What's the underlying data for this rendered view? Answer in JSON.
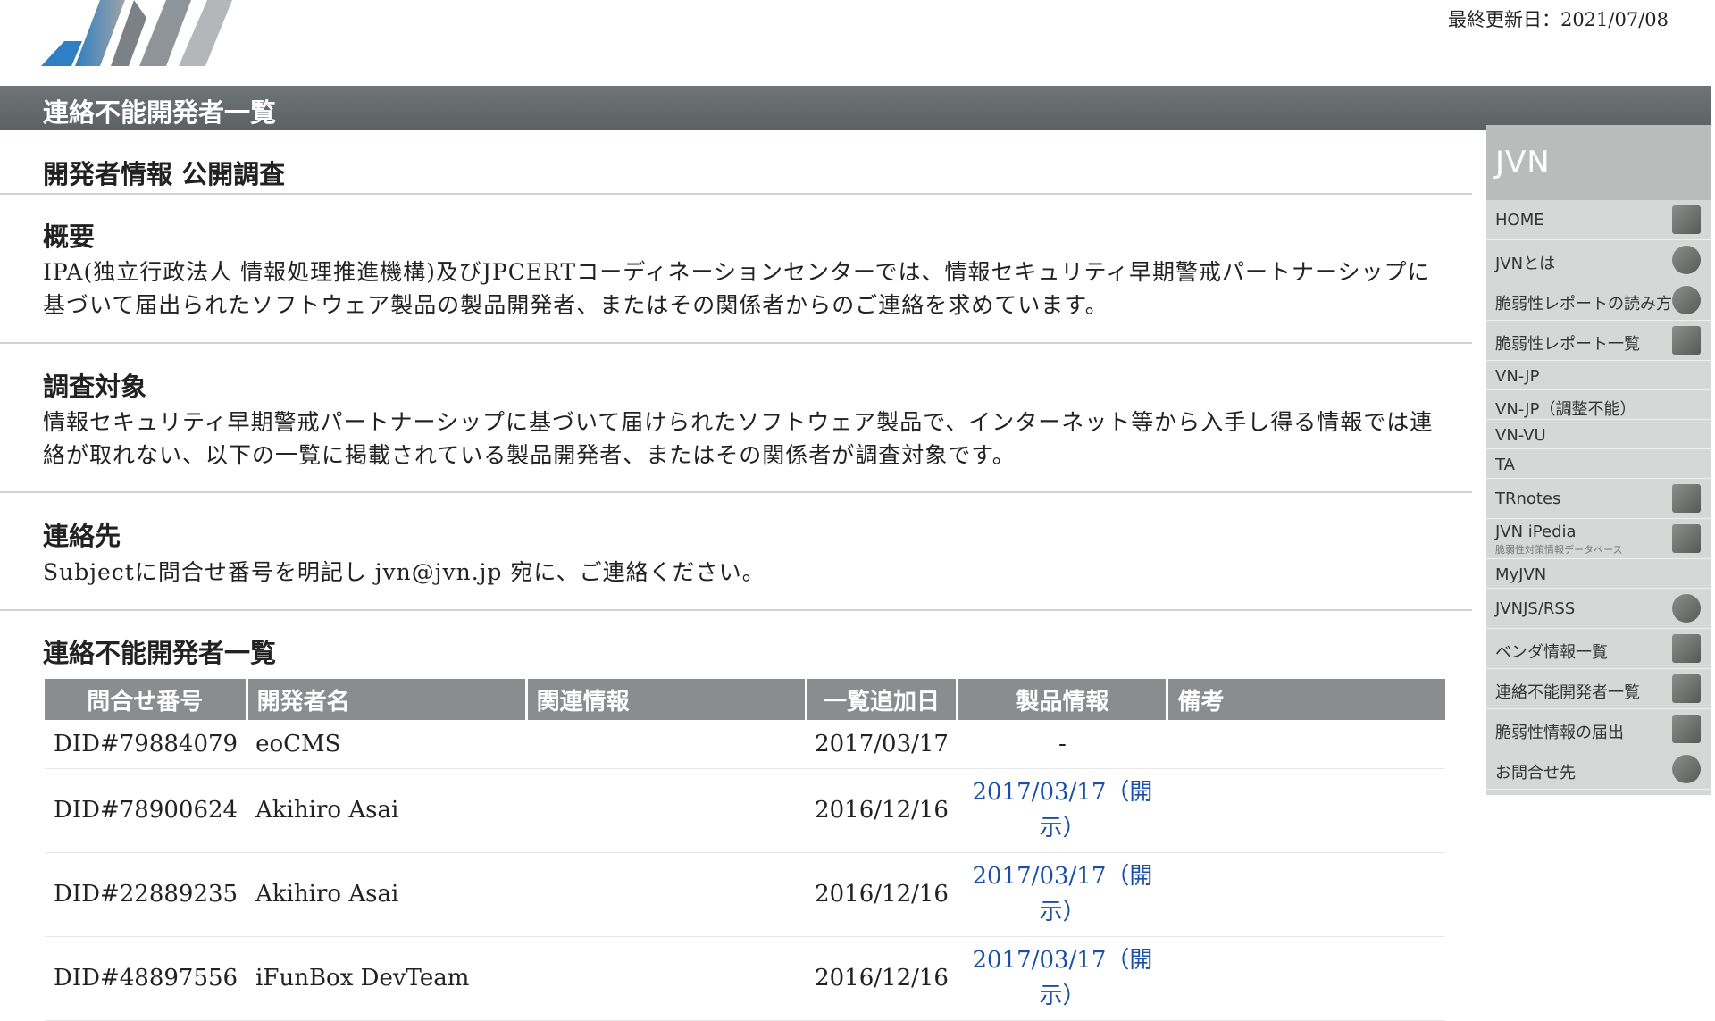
{
  "header": {
    "updated_label": "最終更新日：",
    "updated_date": "2021/07/08",
    "title": "連絡不能開発者一覧"
  },
  "main": {
    "subtitle": "開発者情報 公開調査",
    "sections": [
      {
        "heading": "概要",
        "text": "IPA(独立行政法人 情報処理推進機構)及びJPCERTコーディネーションセンターでは、情報セキュリティ早期警戒パートナーシップに基づいて届出られたソフトウェア製品の製品開発者、またはその関係者からのご連絡を求めています。"
      },
      {
        "heading": "調査対象",
        "text": "情報セキュリティ早期警戒パートナーシップに基づいて届けられたソフトウェア製品で、インターネット等から入手し得る情報では連絡が取れない、以下の一覧に掲載されている製品開発者、またはその関係者が調査対象です。"
      },
      {
        "heading": "連絡先",
        "text": "Subjectに問合せ番号を明記し jvn@jvn.jp 宛に、ご連絡ください。"
      }
    ],
    "list_heading": "連絡不能開発者一覧",
    "table": {
      "headers": [
        "問合せ番号",
        "開発者名",
        "関連情報",
        "一覧追加日",
        "製品情報",
        "備考"
      ],
      "rows": [
        {
          "id": "DID#79884079",
          "developer": "eoCMS",
          "related": "",
          "added": "2017/03/17",
          "product": "-",
          "product_link": false,
          "note": ""
        },
        {
          "id": "DID#78900624",
          "developer": "Akihiro Asai",
          "related": "",
          "added": "2016/12/16",
          "product": "2017/03/17（開示）",
          "product_link": true,
          "note": ""
        },
        {
          "id": "DID#22889235",
          "developer": "Akihiro Asai",
          "related": "",
          "added": "2016/12/16",
          "product": "2017/03/17（開示）",
          "product_link": true,
          "note": ""
        },
        {
          "id": "DID#48897556",
          "developer": "iFunBox DevTeam",
          "related": "",
          "added": "2016/12/16",
          "product": "2017/03/17（開示）",
          "product_link": true,
          "note": ""
        }
      ]
    }
  },
  "sidebar": {
    "brand": "JVN",
    "items": [
      {
        "label": "HOME",
        "icon": "building-icon"
      },
      {
        "label": "JVNとは",
        "icon": "globe-icon"
      },
      {
        "label": "脆弱性レポートの読み方",
        "icon": "eye-icon"
      },
      {
        "label": "脆弱性レポート一覧",
        "icon": "list-icon"
      },
      {
        "label": "VN-JP",
        "icon": ""
      },
      {
        "label": "VN-JP（調整不能）",
        "icon": ""
      },
      {
        "label": "VN-VU",
        "icon": ""
      },
      {
        "label": "TA",
        "icon": ""
      },
      {
        "label": "TRnotes",
        "icon": "pin-icon"
      },
      {
        "label": "JVN iPedia",
        "sub": "脆弱性対策情報データベース",
        "icon": "grid-icon"
      },
      {
        "label": "MyJVN",
        "icon": ""
      },
      {
        "label": "JVNJS/RSS",
        "icon": "globe-icon"
      },
      {
        "label": "ベンダ情報一覧",
        "icon": "doc-icon"
      },
      {
        "label": "連絡不能開発者一覧",
        "icon": "doc-icon"
      },
      {
        "label": "脆弱性情報の届出",
        "icon": "card-icon"
      },
      {
        "label": "お問合せ先",
        "icon": "person-icon"
      }
    ]
  },
  "colors": {
    "titlebar": "#63686a",
    "table_header": "#8a8c8e",
    "link": "#1a4fa8",
    "sidebar_bg": "#d4d8d6"
  }
}
